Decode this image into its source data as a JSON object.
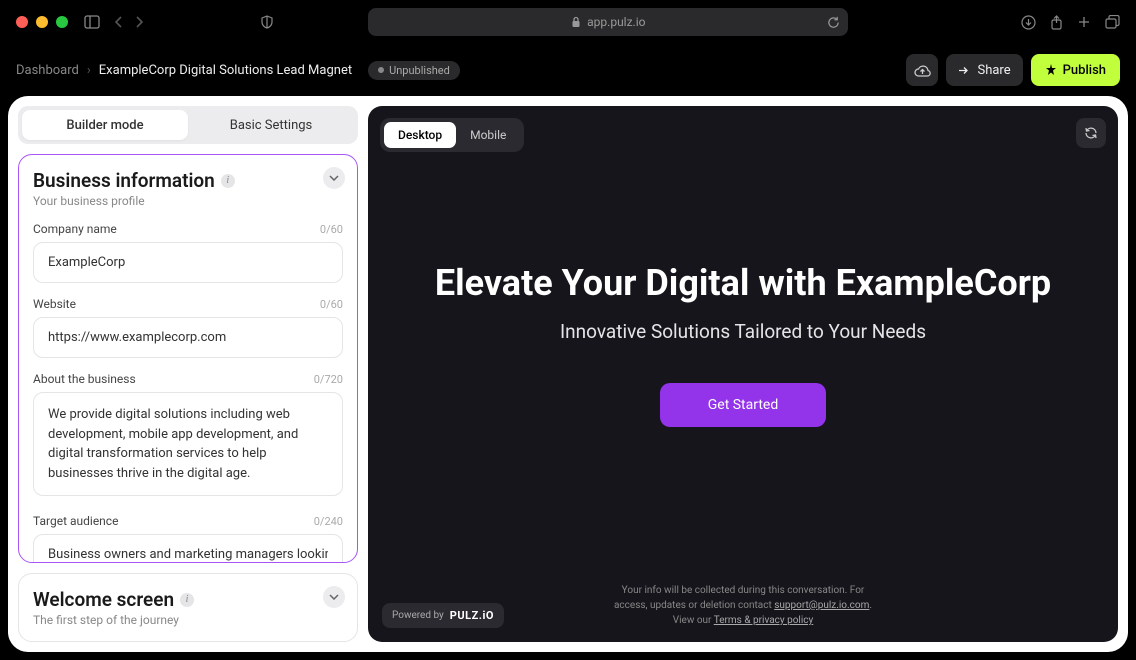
{
  "browser": {
    "url": "app.pulz.io"
  },
  "header": {
    "breadcrumb_root": "Dashboard",
    "breadcrumb_current": "ExampleCorp Digital Solutions Lead Magnet",
    "status": "Unpublished",
    "share": "Share",
    "publish": "Publish"
  },
  "tabs": {
    "builder": "Builder mode",
    "settings": "Basic Settings"
  },
  "business_card": {
    "title": "Business information",
    "subtitle": "Your business profile",
    "fields": {
      "company": {
        "label": "Company name",
        "count": "0/60",
        "value": "ExampleCorp"
      },
      "website": {
        "label": "Website",
        "count": "0/60",
        "value": "https://www.examplecorp.com"
      },
      "about": {
        "label": "About the business",
        "count": "0/720",
        "value": "We provide digital solutions including web development, mobile app development, and digital transformation services to help businesses thrive in the digital age."
      },
      "audience": {
        "label": "Target audience",
        "count": "0/240",
        "value": "Business owners and marketing managers looking for"
      }
    }
  },
  "welcome_card": {
    "title": "Welcome screen",
    "subtitle": "The first step of the journey"
  },
  "preview": {
    "tabs": {
      "desktop": "Desktop",
      "mobile": "Mobile"
    },
    "hero_title": "Elevate Your Digital with ExampleCorp",
    "hero_subtitle": "Innovative Solutions Tailored to Your Needs",
    "cta": "Get Started",
    "powered_prefix": "Powered by",
    "powered_brand": "PULZ.iO",
    "footer_line1": "Your info will be collected during this conversation. For",
    "footer_line2_a": "access, updates or deletion contact ",
    "footer_email": "support@pulz.io.com",
    "footer_line3_a": "View our ",
    "footer_terms": "Terms & privacy policy"
  }
}
